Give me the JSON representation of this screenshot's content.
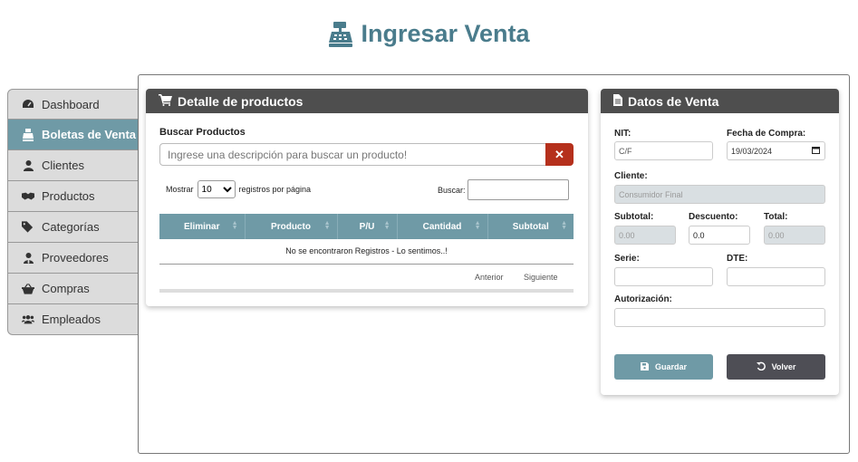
{
  "page": {
    "title": "Ingresar Venta",
    "title_icon": "cash-register-icon",
    "accent_color": "#4a7c8c"
  },
  "sidebar": {
    "items": [
      {
        "label": "Dashboard",
        "icon": "tachometer-icon"
      },
      {
        "label": "Boletas de Venta",
        "icon": "cash-register-icon",
        "active": true
      },
      {
        "label": "Clientes",
        "icon": "user-icon"
      },
      {
        "label": "Productos",
        "icon": "handshake-icon"
      },
      {
        "label": "Categorías",
        "icon": "tags-icon"
      },
      {
        "label": "Proveedores",
        "icon": "user-tie-icon"
      },
      {
        "label": "Compras",
        "icon": "basket-icon"
      },
      {
        "label": "Empleados",
        "icon": "users-icon"
      }
    ]
  },
  "products": {
    "header": "Detalle de productos",
    "search_label": "Buscar Productos",
    "search_placeholder": "Ingrese una descripción para buscar un producto!",
    "show_prefix": "Mostrar",
    "show_value": "10",
    "show_suffix": "registros por página",
    "filter_label": "Buscar:",
    "columns": [
      "Eliminar",
      "Producto",
      "P/U",
      "Cantidad",
      "Subtotal"
    ],
    "empty_message": "No se encontraron Registros - Lo sentimos..!",
    "prev": "Anterior",
    "next": "Siguiente"
  },
  "sale": {
    "header": "Datos de Venta",
    "nit_label": "NIT:",
    "nit_value": "C/F",
    "date_label": "Fecha de Compra:",
    "date_value": "19/03/2024",
    "client_label": "Cliente:",
    "client_value": "Consumidor Final",
    "subtotal_label": "Subtotal:",
    "subtotal_value": "0.00",
    "discount_label": "Descuento:",
    "discount_value": "0.0",
    "total_label": "Total:",
    "total_value": "0.00",
    "serie_label": "Serie:",
    "dte_label": "DTE:",
    "auth_label": "Autorización:",
    "save_label": "Guardar",
    "back_label": "Volver"
  }
}
